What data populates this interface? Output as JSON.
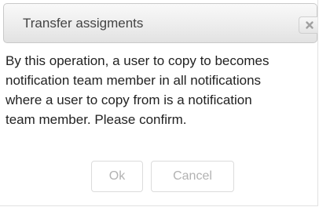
{
  "dialog": {
    "title": "Transfer assigments",
    "close_icon": "close-x-icon",
    "message": "By this operation, a user to copy to becomes\nnotification team member in all notifications\nwhere a user to copy from is a notification\nteam member. Please confirm.",
    "buttons": {
      "ok_label": "Ok",
      "cancel_label": "Cancel"
    }
  }
}
